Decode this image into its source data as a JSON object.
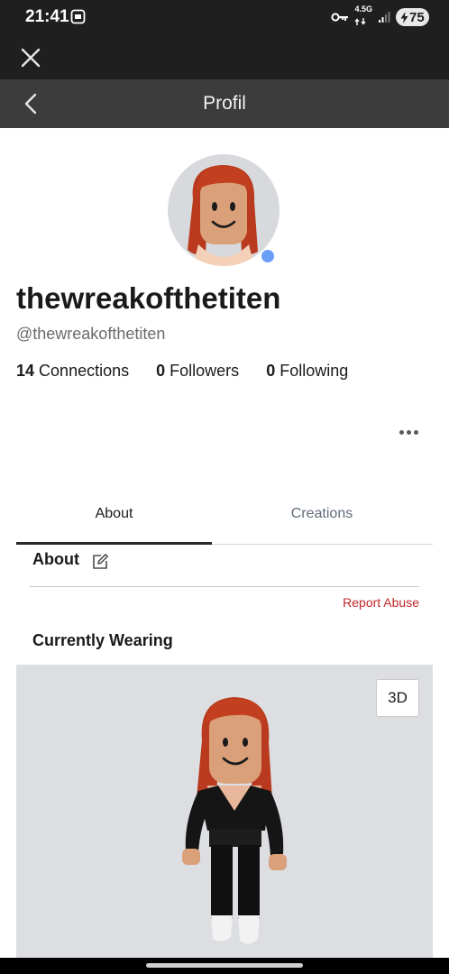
{
  "status_bar": {
    "time": "21:41",
    "network": "4.5G",
    "battery": "75",
    "icons": [
      "screenshot-icon",
      "vpn-key-icon",
      "network-arrows-icon",
      "signal-icon",
      "battery-charging-icon"
    ]
  },
  "browser": {
    "close_icon": "close-icon"
  },
  "nav": {
    "title": "Profil",
    "back_icon": "chevron-left-icon"
  },
  "profile": {
    "display_name": "thewreakofthetiten",
    "username": "@thewreakofthetiten",
    "presence_color": "#6a9df5",
    "stats": {
      "connections_count": "14",
      "connections_label": "Connections",
      "followers_count": "0",
      "followers_label": "Followers",
      "following_count": "0",
      "following_label": "Following"
    },
    "more_icon": "more-horizontal-icon"
  },
  "tabs": [
    {
      "label": "About",
      "active": true
    },
    {
      "label": "Creations",
      "active": false
    }
  ],
  "about": {
    "heading": "About",
    "edit_icon": "edit-icon",
    "report_label": "Report Abuse",
    "report_color": "#c2262b"
  },
  "wearing": {
    "heading": "Currently Wearing",
    "view_button": "3D"
  }
}
